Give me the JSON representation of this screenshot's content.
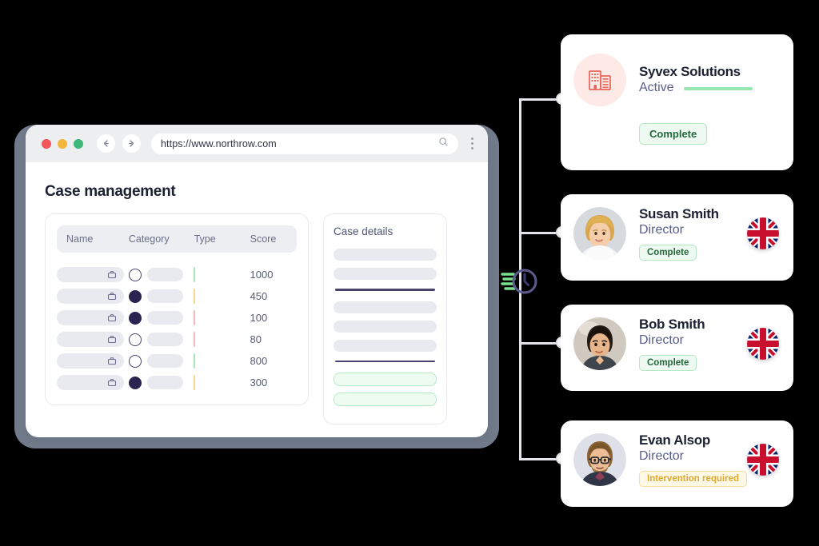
{
  "browser": {
    "url": "https://www.northrow.com",
    "back_icon": "arrow-left-icon",
    "forward_icon": "arrow-right-icon",
    "search_icon": "search-icon",
    "menu_icon": "kebab-menu-icon",
    "traffic_lights": [
      "#f0565c",
      "#f3b63a",
      "#3cb878"
    ]
  },
  "page": {
    "title": "Case management"
  },
  "table": {
    "headers": [
      "Name",
      "Category",
      "Type",
      "Score"
    ],
    "rows": [
      {
        "category_filled": false,
        "type_color": "green",
        "score": "1000"
      },
      {
        "category_filled": true,
        "type_color": "yellow",
        "score": "450"
      },
      {
        "category_filled": true,
        "type_color": "red",
        "score": "100"
      },
      {
        "category_filled": false,
        "type_color": "red",
        "score": "80"
      },
      {
        "category_filled": false,
        "type_color": "green",
        "score": "800"
      },
      {
        "category_filled": true,
        "type_color": "yellow",
        "score": "300"
      }
    ]
  },
  "details": {
    "title": "Case details",
    "skeleton_groups": [
      2,
      3
    ],
    "green_pills": 2
  },
  "connector": {
    "clock_icon": "clock-speed-icon",
    "node_count": 4
  },
  "cards": [
    {
      "type": "company",
      "icon": "office-building-icon",
      "title": "Syvex Solutions",
      "subtitle": "Active",
      "has_progress": true,
      "badge": "Complete",
      "badge_style": "complete",
      "flag": null
    },
    {
      "type": "person",
      "icon": "avatar-woman-blonde",
      "title": "Susan Smith",
      "subtitle": "Director",
      "has_progress": false,
      "badge": "Complete",
      "badge_style": "complete",
      "flag": "uk-flag-icon"
    },
    {
      "type": "person",
      "icon": "avatar-man-dark-hair",
      "title": "Bob Smith",
      "subtitle": "Director",
      "has_progress": false,
      "badge": "Complete",
      "badge_style": "complete",
      "flag": "uk-flag-icon"
    },
    {
      "type": "person",
      "icon": "avatar-man-glasses-beard",
      "title": "Evan Alsop",
      "subtitle": "Director",
      "has_progress": false,
      "badge": "Intervention required",
      "badge_style": "warn",
      "flag": "uk-flag-icon"
    }
  ],
  "colors": {
    "accent_purple": "#4a4370",
    "green": "#96e6ae",
    "coral": "#e8655a",
    "bezel": "#717b8c"
  }
}
